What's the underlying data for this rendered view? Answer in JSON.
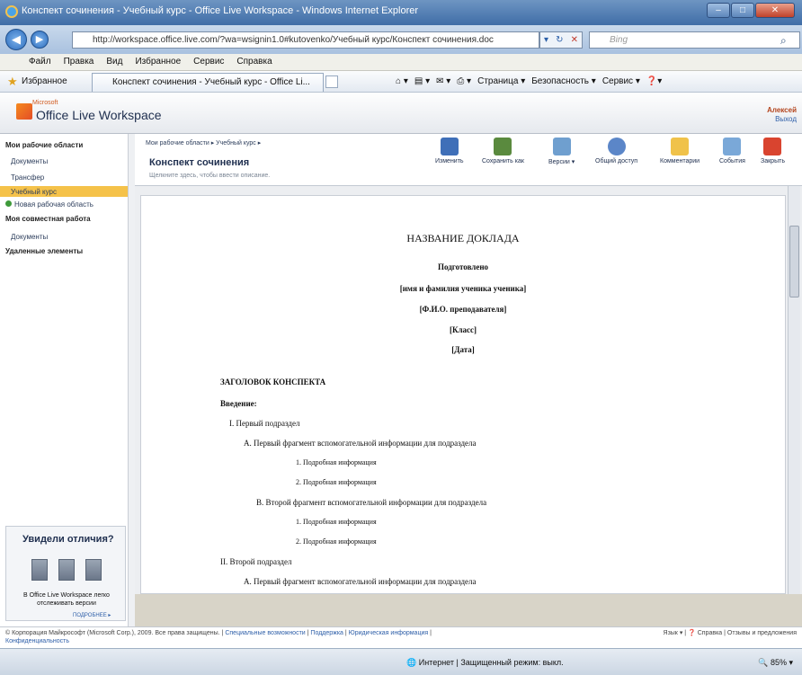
{
  "window": {
    "title": "Конспект сочинения - Учебный курс - Office Live Workspace - Windows Internet Explorer",
    "buttons": [
      "–",
      "□",
      "✕"
    ]
  },
  "address_bar": {
    "url": "http://workspace.office.live.com/?wa=wsignin1.0#kutovenko/Учебный курс/Конспект сочинения.doc",
    "search_placeholder": "Bing"
  },
  "menu": [
    "Файл",
    "Правка",
    "Вид",
    "Избранное",
    "Сервис",
    "Справка"
  ],
  "favorites": {
    "label": "Избранное",
    "tab_title": "Конспект сочинения - Учебный курс - Office Li...",
    "commands": [
      "Страница ▾",
      "Безопасность ▾",
      "Сервис ▾"
    ]
  },
  "header": {
    "ms_label": "Microsoft",
    "app_title": "Office Live Workspace",
    "user_name": "Алексей",
    "logout": "Выход"
  },
  "sidebar": {
    "section1": "Мои рабочие области",
    "items": [
      "Документы",
      "Трансфер",
      "Учебный курс"
    ],
    "new_workspace": "Новая рабочая область",
    "section2": "Моя совместная работа",
    "shared_item": "Документы",
    "section3": "Удаленные элементы",
    "promo_title": "Увидели отличия?",
    "promo_text": "В Office Live Workspace легко отслеживать версии",
    "promo_link": "ПОДРОБНЕЕ ▸"
  },
  "doc_header": {
    "breadcrumb": "Мои рабочие области ▸ Учебный курс ▸",
    "title": "Конспект сочинения",
    "description": "Щелкните здесь, чтобы ввести описание."
  },
  "toolbar": [
    {
      "label": "Изменить",
      "color": "#3f6fb8"
    },
    {
      "label": "Сохранить как",
      "color": "#5a8a3e"
    },
    {
      "label": "Версии ▾",
      "color": "#6f9fcf"
    },
    {
      "label": "Общий доступ",
      "color": "#5b86c8"
    },
    {
      "label": "Комментарии",
      "color": "#f0c24a"
    },
    {
      "label": "События",
      "color": "#7aa8d8"
    },
    {
      "label": "Закрыть",
      "color": "#d9442f"
    }
  ],
  "document": {
    "title": "НАЗВАНИЕ ДОКЛАДА",
    "prepared": "Подготовлено",
    "student": "[имя и фамилия ученика ученика]",
    "teacher": "[Ф.И.О. преподавателя]",
    "class": "[Класс]",
    "date": "[Дата]",
    "outline_title": "ЗАГОЛОВОК КОНСПЕКТА",
    "intro": "Введение:",
    "lines": [
      "I.    Первый подраздел",
      "A.   Первый фрагмент вспомогательной информации для подраздела",
      "1.   Подробная информация",
      "2.   Подробная информация",
      "B.   Второй фрагмент вспомогательной информации для подраздела",
      "1.   Подробная информация",
      "2.   Подробная информация",
      "II.   Второй подраздел",
      "A.   Первый фрагмент вспомогательной информации для подраздела"
    ]
  },
  "footer": {
    "copyright": "© Корпорация Майкрософт (Microsoft Corp.), 2009. Все права защищены.",
    "links": [
      "Специальные возможности",
      "Поддержка",
      "Юридическая информация",
      "Конфиденциальность"
    ],
    "language": "Язык ▾",
    "help": "Справка",
    "feedback": "Отзывы и предложения"
  },
  "statusbar": {
    "zone": "Интернет | Защищенный режим: выкл.",
    "zoom": "85%"
  }
}
